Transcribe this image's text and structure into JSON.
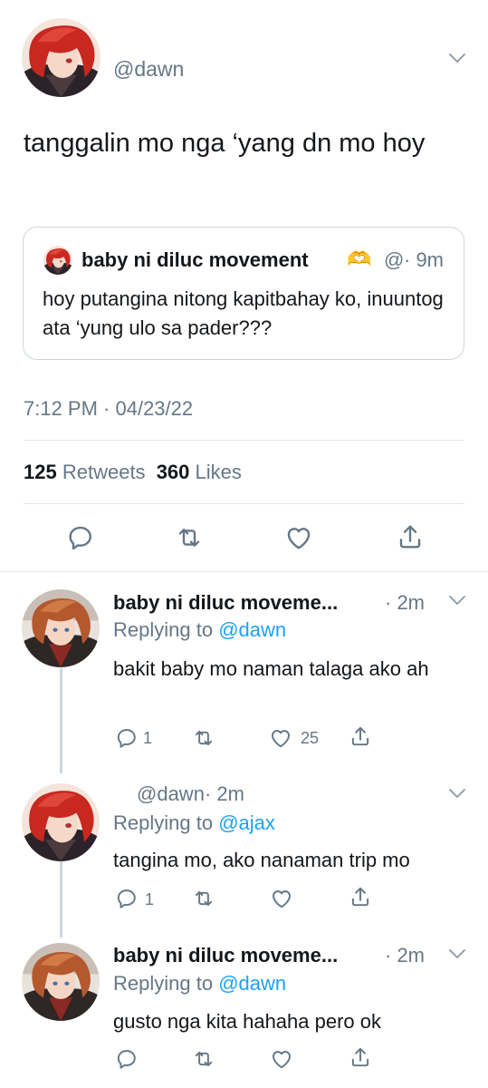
{
  "main_tweet": {
    "handle": "@dawn",
    "text": "tanggalin mo nga ‘yang dn mo hoy",
    "timestamp": "7:12 PM · 04/23/22",
    "retweets_count": "125",
    "retweets_label": "Retweets",
    "likes_count": "360",
    "likes_label": "Likes"
  },
  "quoted_tweet": {
    "name": "baby ni diluc movement",
    "emoji": "🫶",
    "handle": "@",
    "time": "· 9m",
    "text": "hoy putangina nitong kapitbahay ko, inuuntog ata ‘yung ulo sa pader???"
  },
  "replies": [
    {
      "name": "baby ni diluc moveme...",
      "time": "· 2m",
      "replying_prefix": "Replying to",
      "replying_to": "@dawn",
      "text": "bakit baby mo naman talaga ako ah",
      "reply_count": "1",
      "like_count": "25"
    },
    {
      "handle": "@dawn",
      "time": "· 2m",
      "replying_prefix": "Replying to",
      "replying_to": "@ajax",
      "text": "tangina mo, ako nanaman trip mo",
      "reply_count": "1"
    },
    {
      "name": "baby ni diluc moveme...",
      "time": "· 2m",
      "replying_prefix": "Replying to",
      "replying_to": "@dawn",
      "text": "gusto nga kita hahaha pero ok"
    }
  ],
  "colors": {
    "accent": "#1da1f2",
    "secondary_text": "#657786",
    "divider": "#e1e8ed"
  },
  "icons": [
    "reply-icon",
    "retweet-icon",
    "like-icon",
    "share-icon",
    "chevron-down-icon"
  ]
}
